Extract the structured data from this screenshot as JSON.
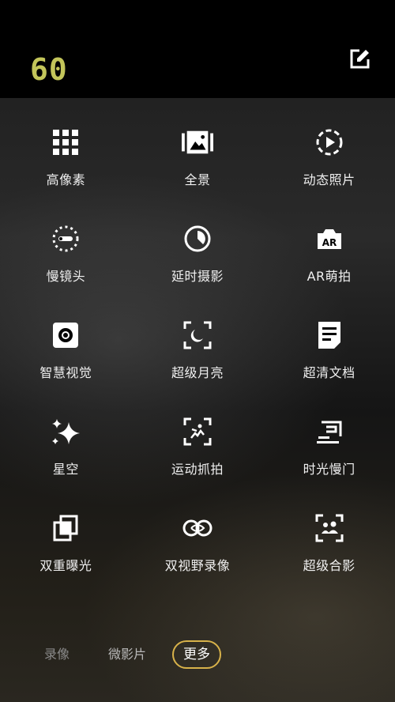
{
  "header": {
    "fps_badge": "60",
    "edit_icon": "edit-icon"
  },
  "modes": [
    {
      "label": "高像素",
      "icon": "grid-icon"
    },
    {
      "label": "全景",
      "icon": "panorama-icon"
    },
    {
      "label": "动态照片",
      "icon": "motion-photo-icon"
    },
    {
      "label": "慢镜头",
      "icon": "slow-motion-icon"
    },
    {
      "label": "延时摄影",
      "icon": "timelapse-icon"
    },
    {
      "label": "AR萌拍",
      "icon": "ar-camera-icon"
    },
    {
      "label": "智慧视觉",
      "icon": "smart-vision-icon"
    },
    {
      "label": "超级月亮",
      "icon": "super-moon-icon"
    },
    {
      "label": "超清文档",
      "icon": "document-icon"
    },
    {
      "label": "星空",
      "icon": "sparkle-icon"
    },
    {
      "label": "运动抓拍",
      "icon": "sport-capture-icon"
    },
    {
      "label": "时光慢门",
      "icon": "slow-shutter-icon"
    },
    {
      "label": "双重曝光",
      "icon": "double-exposure-icon"
    },
    {
      "label": "双视野录像",
      "icon": "dual-view-icon"
    },
    {
      "label": "超级合影",
      "icon": "group-photo-icon"
    }
  ],
  "tabs": [
    {
      "label": "录像",
      "state": "dim"
    },
    {
      "label": "微影片",
      "state": "normal"
    },
    {
      "label": "更多",
      "state": "active"
    }
  ],
  "colors": {
    "fps_badge": "#c3c55a",
    "active_tab_border": "#d8b24a",
    "icon": "#ffffff"
  }
}
